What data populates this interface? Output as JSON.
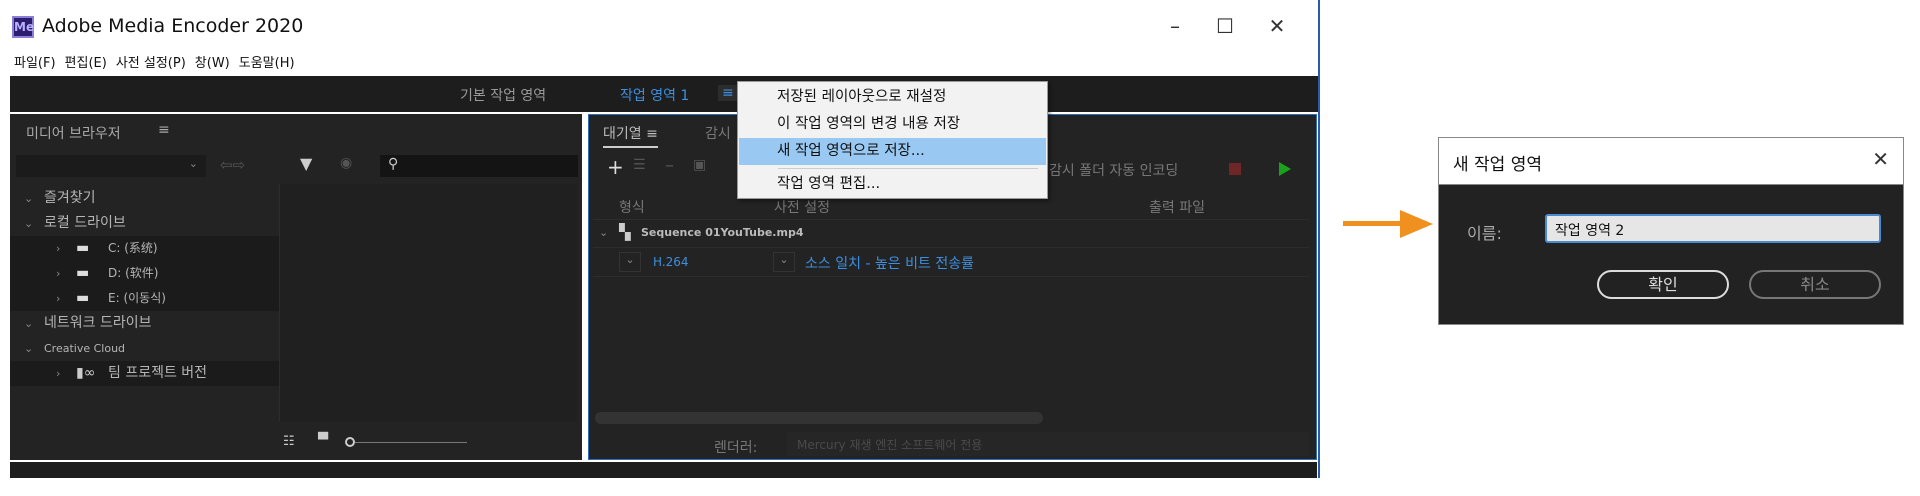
{
  "window": {
    "title": "Adobe Media Encoder 2020",
    "logo": "Me",
    "minimize": "–",
    "maximize": "☐",
    "close": "✕"
  },
  "menubar": [
    "파일(F)",
    "편집(E)",
    "사전 설정(P)",
    "창(W)",
    "도움말(H)"
  ],
  "workspaces": {
    "default": "기본 작업 영역",
    "current": "작업 영역 1",
    "menu_icon": "≡"
  },
  "media_browser": {
    "title": "미디어 브라우저",
    "menu_icon": "≡",
    "search_icon": "⚲",
    "tree": [
      {
        "label": "즐겨찾기",
        "level": 0
      },
      {
        "label": "로컬 드라이브",
        "level": 0
      },
      {
        "label": "C: (系统)",
        "level": 1
      },
      {
        "label": "D: (软件)",
        "level": 1
      },
      {
        "label": "E: (이동식)",
        "level": 1
      },
      {
        "label": "네트워크 드라이브",
        "level": 0
      },
      {
        "label": "Creative Cloud",
        "level": 0
      },
      {
        "label": "팀 프로젝트 버전",
        "level": 1
      }
    ]
  },
  "queue": {
    "tab_queue": "대기열",
    "tab_watch": "감시",
    "menu_icon": "≡",
    "auto_encode": "감시 폴더 자동 인코딩",
    "columns": {
      "format": "형식",
      "preset": "사전 설정",
      "output": "출력 파일"
    },
    "item": {
      "source": "Sequence 01YouTube.mp4",
      "format": "H.264",
      "preset": "소스 일치 - 높은 비트 전송률"
    },
    "renderer_label": "렌더러:",
    "renderer_value": "Mercury 재생 엔진 소프트웨어 전용"
  },
  "workspace_menu": [
    "저장된 레이아웃으로 재설정",
    "이 작업 영역의 변경 내용 저장",
    "새 작업 영역으로 저장...",
    "작업 영역 편집..."
  ],
  "dialog": {
    "title": "새 작업 영역",
    "close": "✕",
    "name_label": "이름:",
    "name_value": "작업 영역 2",
    "ok": "확인",
    "cancel": "취소"
  },
  "colors": {
    "accent": "#3d8fe0",
    "arrow": "#f0901e",
    "highlight": "#99c9f2"
  }
}
